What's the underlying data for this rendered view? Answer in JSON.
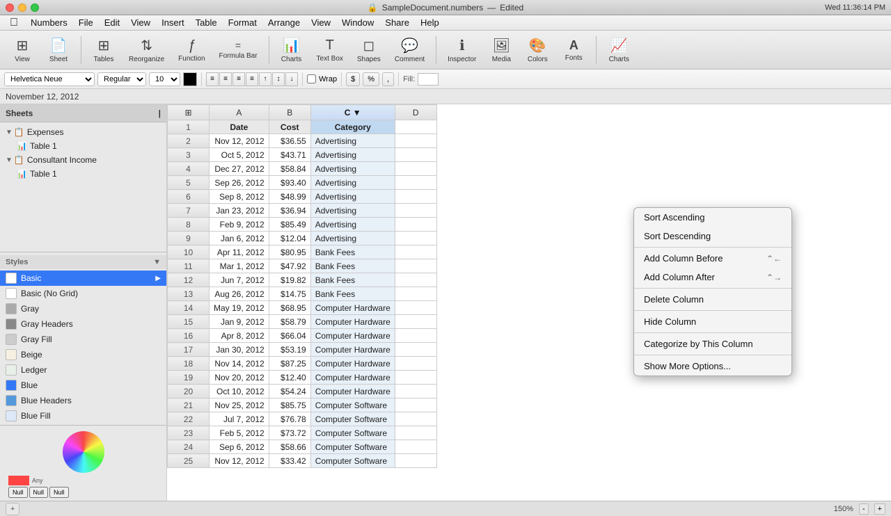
{
  "app": {
    "name": "Numbers",
    "document_title": "SampleDocument.numbers",
    "document_status": "Edited",
    "date": "November 12, 2012",
    "time": "Wed 11:36:14 PM"
  },
  "menus": [
    "",
    "Numbers",
    "File",
    "Edit",
    "View",
    "Insert",
    "Table",
    "Format",
    "Arrange",
    "View",
    "Window",
    "Share",
    "Help"
  ],
  "toolbar": {
    "buttons": [
      {
        "id": "view",
        "icon": "⊞",
        "label": "View"
      },
      {
        "id": "sheet",
        "icon": "📄",
        "label": "Sheet"
      },
      {
        "id": "tables",
        "icon": "⊞",
        "label": "Tables"
      },
      {
        "id": "reorganize",
        "icon": "⇅",
        "label": "Reorganize"
      },
      {
        "id": "function",
        "icon": "ƒ",
        "label": "Function"
      },
      {
        "id": "formula_bar",
        "icon": "=",
        "label": "Formula Bar"
      },
      {
        "id": "charts",
        "icon": "📊",
        "label": "Charts"
      },
      {
        "id": "text_box",
        "icon": "T",
        "label": "Text Box"
      },
      {
        "id": "shapes",
        "icon": "◻",
        "label": "Shapes"
      },
      {
        "id": "comment",
        "icon": "💬",
        "label": "Comment"
      },
      {
        "id": "inspector",
        "icon": "ℹ",
        "label": "Inspector"
      },
      {
        "id": "media",
        "icon": "🖼",
        "label": "Media"
      },
      {
        "id": "colors",
        "icon": "🎨",
        "label": "Colors"
      },
      {
        "id": "fonts",
        "icon": "A",
        "label": "Fonts"
      },
      {
        "id": "charts2",
        "icon": "📈",
        "label": "Charts"
      }
    ]
  },
  "formatbar": {
    "font_family": "Helvetica Neue",
    "font_style": "Regular",
    "font_size": "10",
    "fill_label": "Fill:"
  },
  "sidebar": {
    "sheets_label": "Sheets",
    "items": [
      {
        "id": "expenses",
        "label": "Expenses",
        "type": "sheet",
        "indent": 0,
        "expanded": true
      },
      {
        "id": "table1_expenses",
        "label": "Table 1",
        "type": "table",
        "indent": 1,
        "selected": false
      },
      {
        "id": "consultant",
        "label": "Consultant Income",
        "type": "sheet",
        "indent": 0,
        "expanded": true
      },
      {
        "id": "table1_consultant",
        "label": "Table 1",
        "type": "table",
        "indent": 1,
        "selected": false
      }
    ],
    "styles_label": "Styles",
    "styles": [
      {
        "id": "basic",
        "label": "Basic",
        "selected": true,
        "color": "#ffffff",
        "has_arrow": true
      },
      {
        "id": "basic_no_grid",
        "label": "Basic (No Grid)",
        "selected": false,
        "color": "#ffffff"
      },
      {
        "id": "gray",
        "label": "Gray",
        "selected": false,
        "color": "#888888"
      },
      {
        "id": "gray_headers",
        "label": "Gray Headers",
        "selected": false,
        "color": "#aaaaaa"
      },
      {
        "id": "gray_fill",
        "label": "Gray Fill",
        "selected": false,
        "color": "#cccccc"
      },
      {
        "id": "beige",
        "label": "Beige",
        "selected": false,
        "color": "#f5f0e0"
      },
      {
        "id": "ledger",
        "label": "Ledger",
        "selected": false,
        "color": "#e8f0e8"
      },
      {
        "id": "blue",
        "label": "Blue",
        "selected": false,
        "color": "#3478f6"
      },
      {
        "id": "blue_headers",
        "label": "Blue Headers",
        "selected": false,
        "color": "#5599dd"
      },
      {
        "id": "blue_fill",
        "label": "Blue Fill",
        "selected": false,
        "color": "#dde8f8"
      }
    ]
  },
  "table": {
    "columns": [
      "Date",
      "Cost",
      "Category"
    ],
    "col_letters": [
      "A",
      "B",
      "C",
      "D"
    ],
    "active_col": "C",
    "rows": [
      {
        "row": 1,
        "date": "Date",
        "cost": "Cost",
        "category": "Category",
        "is_header": true
      },
      {
        "row": 2,
        "date": "Nov 12, 2012",
        "cost": "$36.55",
        "category": "Advertising"
      },
      {
        "row": 3,
        "date": "Oct 5, 2012",
        "cost": "$43.71",
        "category": "Advertising"
      },
      {
        "row": 4,
        "date": "Dec 27, 2012",
        "cost": "$58.84",
        "category": "Advertising"
      },
      {
        "row": 5,
        "date": "Sep 26, 2012",
        "cost": "$93.40",
        "category": "Advertising"
      },
      {
        "row": 6,
        "date": "Sep 8, 2012",
        "cost": "$48.99",
        "category": "Advertising"
      },
      {
        "row": 7,
        "date": "Jan 23, 2012",
        "cost": "$36.94",
        "category": "Advertising"
      },
      {
        "row": 8,
        "date": "Feb 9, 2012",
        "cost": "$85.49",
        "category": "Advertising"
      },
      {
        "row": 9,
        "date": "Jan 6, 2012",
        "cost": "$12.04",
        "category": "Advertising"
      },
      {
        "row": 10,
        "date": "Apr 11, 2012",
        "cost": "$80.95",
        "category": "Bank Fees"
      },
      {
        "row": 11,
        "date": "Mar 1, 2012",
        "cost": "$47.92",
        "category": "Bank Fees"
      },
      {
        "row": 12,
        "date": "Jun 7, 2012",
        "cost": "$19.82",
        "category": "Bank Fees"
      },
      {
        "row": 13,
        "date": "Aug 26, 2012",
        "cost": "$14.75",
        "category": "Bank Fees"
      },
      {
        "row": 14,
        "date": "May 19, 2012",
        "cost": "$68.95",
        "category": "Computer Hardware"
      },
      {
        "row": 15,
        "date": "Jan 9, 2012",
        "cost": "$58.79",
        "category": "Computer Hardware"
      },
      {
        "row": 16,
        "date": "Apr 8, 2012",
        "cost": "$66.04",
        "category": "Computer Hardware"
      },
      {
        "row": 17,
        "date": "Jan 30, 2012",
        "cost": "$53.19",
        "category": "Computer Hardware"
      },
      {
        "row": 18,
        "date": "Nov 14, 2012",
        "cost": "$87.25",
        "category": "Computer Hardware"
      },
      {
        "row": 19,
        "date": "Nov 20, 2012",
        "cost": "$12.40",
        "category": "Computer Hardware"
      },
      {
        "row": 20,
        "date": "Oct 10, 2012",
        "cost": "$54.24",
        "category": "Computer Hardware"
      },
      {
        "row": 21,
        "date": "Nov 25, 2012",
        "cost": "$85.75",
        "category": "Computer Software"
      },
      {
        "row": 22,
        "date": "Jul 7, 2012",
        "cost": "$76.78",
        "category": "Computer Software"
      },
      {
        "row": 23,
        "date": "Feb 5, 2012",
        "cost": "$73.72",
        "category": "Computer Software"
      },
      {
        "row": 24,
        "date": "Sep 6, 2012",
        "cost": "$58.66",
        "category": "Computer Software"
      },
      {
        "row": 25,
        "date": "Nov 12, 2012",
        "cost": "$33.42",
        "category": "Computer Software"
      }
    ]
  },
  "context_menu": {
    "items": [
      {
        "id": "sort_asc",
        "label": "Sort Ascending",
        "shortcut": "",
        "type": "item"
      },
      {
        "id": "sort_desc",
        "label": "Sort Descending",
        "shortcut": "",
        "type": "item"
      },
      {
        "type": "sep"
      },
      {
        "id": "add_before",
        "label": "Add Column Before",
        "shortcut": "⌃←",
        "type": "item"
      },
      {
        "id": "add_after",
        "label": "Add Column After",
        "shortcut": "⌃→",
        "type": "item"
      },
      {
        "type": "sep"
      },
      {
        "id": "delete_col",
        "label": "Delete Column",
        "shortcut": "",
        "type": "item"
      },
      {
        "type": "sep"
      },
      {
        "id": "hide_col",
        "label": "Hide Column",
        "shortcut": "",
        "type": "item"
      },
      {
        "type": "sep"
      },
      {
        "id": "categorize",
        "label": "Categorize by This Column",
        "shortcut": "",
        "type": "item"
      },
      {
        "type": "sep"
      },
      {
        "id": "more_options",
        "label": "Show More Options...",
        "shortcut": "",
        "type": "item"
      }
    ]
  },
  "statusbar": {
    "zoom": "150%",
    "controls": [
      "-",
      "+"
    ]
  }
}
